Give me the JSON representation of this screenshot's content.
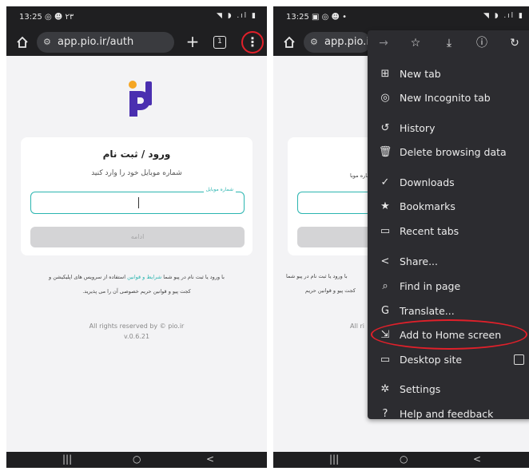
{
  "left": {
    "status": {
      "time": "13:25 ◎ ☻ ۲۳",
      "icons": "◥ ◗ .ıl ▮"
    },
    "toolbar": {
      "url": "app.pio.ir/auth",
      "tab_count": "1",
      "plus": "+",
      "more": "⋮"
    },
    "page": {
      "title": "ورود / ثبت نام",
      "subtitle": "شماره موبایل خود را وارد کنید",
      "field_label": "شماره موبایل",
      "field_value": "",
      "continue_label": "ادامه",
      "terms_line1_a": "با ورود یا ثبت نام در پیو شما",
      "terms_link": "شرایط و قوانین",
      "terms_line1_b": "استفاده از سرویس های اپلیکیشن و",
      "terms_line2": "کجت پیو و قوانین حریم خصوصی آن را می پذیرید.",
      "footer_line1": "All rights reserved by © pio.ir",
      "footer_line2": "v.0.6.21"
    },
    "nav": {
      "recents": "|||",
      "home": "○",
      "back": "<"
    }
  },
  "right": {
    "status": {
      "time": "13:25 ▣ ◎ ☻ •",
      "icons": "◥ ◗ .ıl ▮"
    },
    "toolbar": {
      "url": "app.pio.i"
    },
    "menu_top": {
      "forward": "→",
      "bookmark": "☆",
      "download": "⤓",
      "info": "ⓘ",
      "refresh": "↻"
    },
    "menu": [
      {
        "label": "New tab",
        "icon": "⊞"
      },
      {
        "label": "New Incognito tab",
        "icon": "◎"
      },
      {
        "label": "History",
        "icon": "↺"
      },
      {
        "label": "Delete browsing data",
        "icon": "🗑"
      },
      {
        "label": "Downloads",
        "icon": "✓"
      },
      {
        "label": "Bookmarks",
        "icon": "★"
      },
      {
        "label": "Recent tabs",
        "icon": "▭"
      },
      {
        "label": "Share...",
        "icon": "<"
      },
      {
        "label": "Find in page",
        "icon": "⌕"
      },
      {
        "label": "Translate...",
        "icon": "G"
      },
      {
        "label": "Add to Home screen",
        "icon": "⇲"
      },
      {
        "label": "Desktop site",
        "icon": "▭"
      },
      {
        "label": "Settings",
        "icon": "✲"
      },
      {
        "label": "Help and feedback",
        "icon": "?"
      }
    ],
    "partial": {
      "line_a": "با ورود یا ثبت نام در پیو شما",
      "line_b": "کجت پیو و قوانین حریم",
      "line_c": "All ri",
      "sub": "شماره موبا"
    },
    "nav": {
      "recents": "|||",
      "home": "○",
      "back": "<"
    }
  },
  "colors": {
    "accent": "#2bb5b0",
    "logo_purple": "#4a2fb0",
    "logo_orange": "#f5a623",
    "highlight": "#e0202a"
  }
}
